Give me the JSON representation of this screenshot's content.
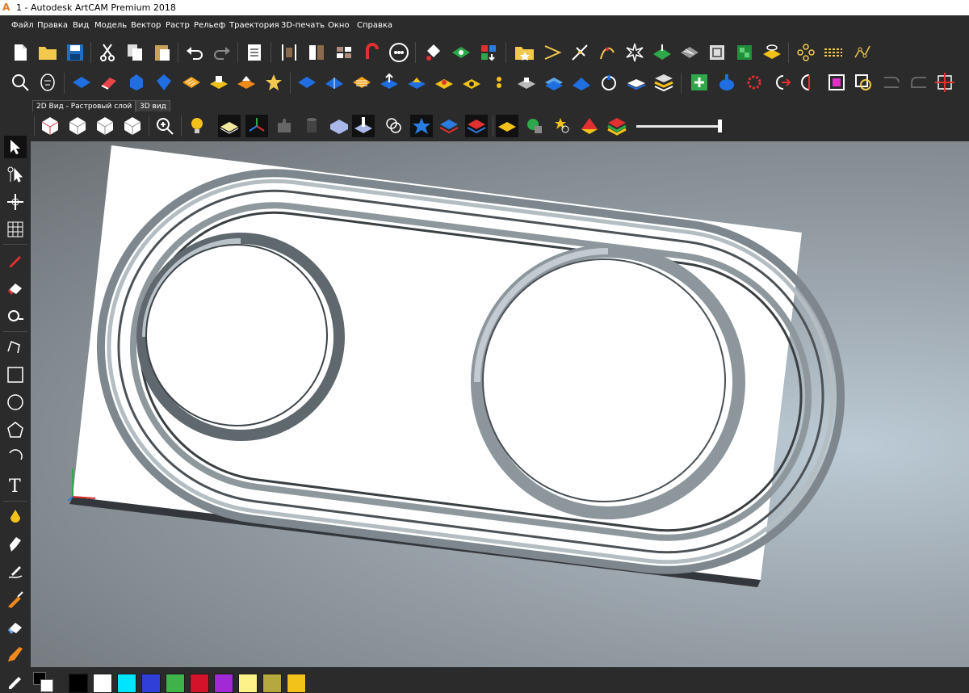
{
  "window": {
    "title": "1 - Autodesk ArtCAM Premium 2018"
  },
  "menu": [
    "Файл",
    "Правка",
    "Вид",
    "Модель",
    "Вектор",
    "Растр",
    "Рельеф",
    "Траектория",
    "3D-печать",
    "Окно",
    "Справка"
  ],
  "tabs": [
    "2D Вид - Растровый слой",
    "3D вид"
  ],
  "active_tab": "3D вид",
  "toolbar_row1_icons": [
    "new-file-icon",
    "open-folder-icon",
    "save-icon",
    "cut-icon",
    "copy-icon",
    "paste-icon",
    "undo-icon",
    "redo-icon",
    "notes-icon",
    "set-model-size-icon",
    "split-icon",
    "grid-icon",
    "magnet-icon",
    "bitmap-icon",
    "paint-bucket-icon",
    "layer-icon",
    "color-select-icon",
    "import-folder-icon",
    "arrow-vector-icon",
    "trim-icon",
    "curve-icon",
    "star-burst-icon",
    "relief-layer-icon",
    "weave-icon",
    "frame-icon",
    "texture-icon",
    "plate-icon",
    "nodes-icon",
    "align-icon",
    "node-path-icon"
  ],
  "toolbar_row2_icons": [
    "zoom-fit-icon",
    "face-icon",
    "blue-shape-icon",
    "red-eraser-icon",
    "extrude-icon",
    "network-icon",
    "weave-texture-icon",
    "yellow-block-icon",
    "orange-block-icon",
    "star-relief-icon",
    "blue-relief-icon",
    "fold-icon",
    "lines-relief-icon",
    "lift-icon",
    "spin-relief-icon",
    "dome-icon",
    "target-icon",
    "dot-icon",
    "machine-icon",
    "bend-icon",
    "sweep-icon",
    "recycle-icon",
    "flat-relief-icon",
    "layers-relief-icon",
    "add-green-icon",
    "pot-icon",
    "gear-red-icon",
    "half-arrow-icon",
    "rotate-icon",
    "magenta-square-icon",
    "offset-icon",
    "bracket-icon",
    "bracket2-icon",
    "crosshair-icon"
  ],
  "view_toolbar_icons": [
    "iso-view-icon",
    "front-view-icon",
    "back-view-icon",
    "top-view-icon",
    "zoom-icon",
    "light-bulb-icon",
    "plane-icon",
    "axes-icon",
    "puzzle-icon",
    "cylinder-icon",
    "block-view-icon",
    "probe-icon",
    "rotate-view-icon",
    "star-view-icon",
    "layer-stack-icon",
    "red-layer-icon",
    "yellow-plane-icon",
    "green-circle-icon",
    "star-zoom-icon",
    "pyramid-icon",
    "color-layers-icon"
  ],
  "left_tools": [
    "pointer-icon",
    "node-edit-icon",
    "transform-icon",
    "mesh-icon",
    "pencil-icon",
    "eraser-icon",
    "measure-icon",
    "polyline-icon",
    "rectangle-icon",
    "circle-icon",
    "polygon-icon",
    "arc-icon",
    "text-icon",
    "drop-icon",
    "smudge-icon",
    "sculpt-icon",
    "knife-icon",
    "rubber-icon",
    "brush-icon",
    "pen-icon"
  ],
  "palette": [
    "#000000",
    "#ffffff",
    "#00e5ff",
    "#2f3fd8",
    "#3db34a",
    "#d4132a",
    "#a22ad6",
    "#fbf38a",
    "#b5a83f",
    "#f2c21b"
  ],
  "colors": {
    "background": "#2b2b2b",
    "viewport_center": "#bccbd6",
    "material": "#ffffff",
    "groove": "#8e979c"
  }
}
